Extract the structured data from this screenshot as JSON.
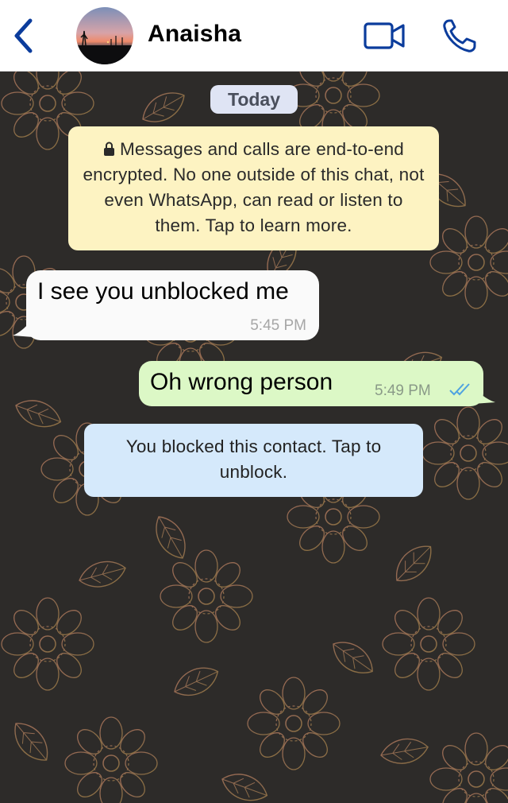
{
  "header": {
    "contact_name": "Anaisha",
    "icons": {
      "back": "chevron-left-icon",
      "video": "video-call-icon",
      "call": "phone-icon"
    },
    "accent_color": "#0b3c9c"
  },
  "chat": {
    "date_label": "Today",
    "encryption_notice": "Messages and calls are end-to-end encrypted. No one outside of this chat, not even WhatsApp, can read or listen to them. Tap to learn more.",
    "messages": [
      {
        "direction": "incoming",
        "text": "I see you unblocked me",
        "time": "5:45 PM"
      },
      {
        "direction": "outgoing",
        "text": "Oh wrong person",
        "time": "5:49 PM",
        "status": "read"
      }
    ],
    "blocked_notice": "You blocked this contact. Tap to unblock."
  }
}
